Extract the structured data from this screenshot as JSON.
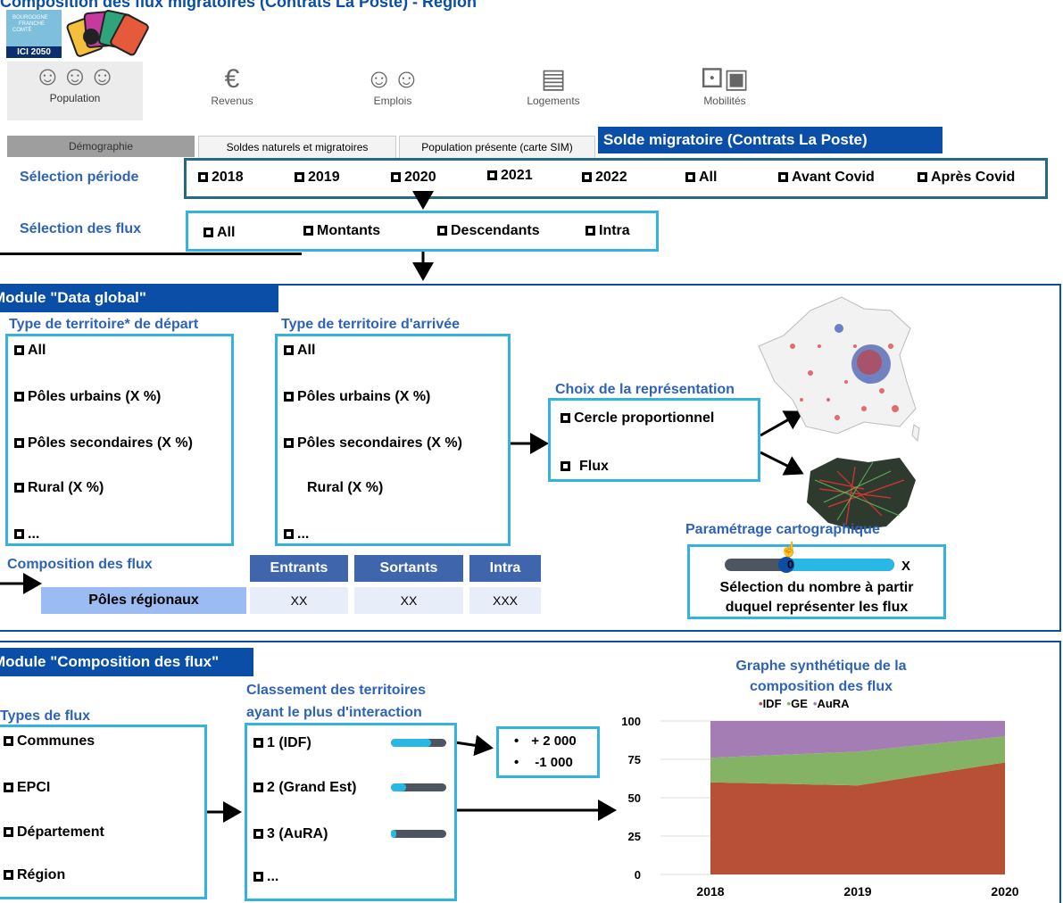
{
  "header": {
    "title": "Composition des flux migratoires (Contrats La Poste) - Région",
    "logo_text_1": "BOURGOGNE",
    "logo_text_2": "FRANCHE",
    "logo_text_3": "COMTÉ",
    "logo_badge": "ICI 2050"
  },
  "nav": [
    {
      "label": "Population",
      "icon": "people-icon"
    },
    {
      "label": "Revenus",
      "icon": "money-bag-icon"
    },
    {
      "label": "Emplois",
      "icon": "workers-icon"
    },
    {
      "label": "Logements",
      "icon": "building-icon"
    },
    {
      "label": "Mobilités",
      "icon": "car-bus-icon"
    }
  ],
  "tabs": [
    "Démographie",
    "Soldes naturels et migratoires",
    "Population présente (carte SIM)",
    "Solde migratoire (Contrats La Poste)"
  ],
  "periode": {
    "label": "Sélection période",
    "options": [
      "2018",
      "2019",
      "2020",
      "2021",
      "2022",
      "All",
      "Avant Covid",
      "Après Covid"
    ]
  },
  "flux": {
    "label": "Sélection des flux",
    "options": [
      "All",
      "Montants",
      "Descendants",
      "Intra"
    ]
  },
  "global": {
    "title": "Module \"Data global\"",
    "depart": {
      "title": "Type de territoire* de départ",
      "options": [
        "All",
        "Pôles urbains (X %)",
        "Pôles secondaires (X %)",
        "Rural (X %)",
        "..."
      ]
    },
    "arrivee": {
      "title": "Type de territoire d'arrivée",
      "options": [
        "All",
        "Pôles urbains (X %)",
        "Pôles secondaires (X %)",
        "Rural (X %)",
        "..."
      ]
    },
    "representation": {
      "title": "Choix de la représentation",
      "options": [
        "Cercle proportionnel",
        "Flux"
      ]
    },
    "param": {
      "title": "Paramétrage cartographique",
      "slider_min": "0",
      "slider_max": "X",
      "slider_value": 0.0,
      "desc_1": "Sélection du nombre à partir",
      "desc_2": "duquel représenter les flux"
    },
    "composition": {
      "label": "Composition des flux",
      "headers": [
        "Entrants",
        "Sortants",
        "Intra"
      ],
      "row_label": "Pôles régionaux",
      "row_values": [
        "XX",
        "XX",
        "XXX"
      ]
    }
  },
  "compo": {
    "title": "Module \"Composition des flux\"",
    "types_title": "Types de flux",
    "types": [
      "Communes",
      "EPCI",
      "Département",
      "Région"
    ],
    "classement_title_1": "Classement des territoires",
    "classement_title_2": "ayant le plus d'interaction",
    "classement": [
      {
        "label": "1 (IDF)",
        "level": 0.72
      },
      {
        "label": "2 (Grand Est)",
        "level": 0.28
      },
      {
        "label": "3 (AuRA)",
        "level": 0.1
      },
      {
        "label": "...",
        "level": null
      }
    ],
    "values": [
      "+ 2 000",
      "-1 000"
    ],
    "chart_title_1": "Graphe synthétique de la",
    "chart_title_2": "composition des flux"
  },
  "chart_data": {
    "type": "area",
    "title": "Graphe synthétique de la composition des flux",
    "categories": [
      "2018",
      "2019",
      "2020"
    ],
    "series": [
      {
        "name": "IDF",
        "color": "#b84f37",
        "values": [
          60,
          58,
          73
        ]
      },
      {
        "name": "GE",
        "color": "#84b365",
        "values": [
          16,
          22,
          17
        ]
      },
      {
        "name": "AuRA",
        "color": "#a57db5",
        "values": [
          24,
          20,
          10
        ]
      }
    ],
    "yticks": [
      0,
      25,
      50,
      75,
      100
    ],
    "ylim": [
      0,
      100
    ],
    "stacked": true,
    "legend": "top"
  }
}
